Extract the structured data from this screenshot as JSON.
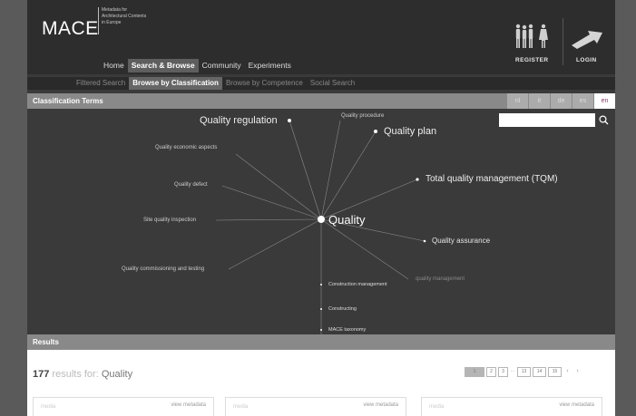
{
  "header": {
    "logo": "MACE",
    "tagline_lines": [
      "Metadata for",
      "Architectural Contents",
      "in Europe"
    ],
    "register_label": "REGISTER",
    "login_label": "LOGIN"
  },
  "nav": {
    "items": [
      {
        "label": "Home",
        "active": false
      },
      {
        "label": "Search & Browse",
        "active": true
      },
      {
        "label": "Community",
        "active": false
      },
      {
        "label": "Experiments",
        "active": false
      }
    ]
  },
  "subnav": {
    "items": [
      {
        "label": "Filtered Search",
        "active": false
      },
      {
        "label": "Browse by Classification",
        "active": true
      },
      {
        "label": "Browse by Competence",
        "active": false
      },
      {
        "label": "Social Search",
        "active": false
      }
    ]
  },
  "classification": {
    "title": "Classification Terms",
    "languages": [
      {
        "code": "nl",
        "active": false
      },
      {
        "code": "it",
        "active": false
      },
      {
        "code": "de",
        "active": false
      },
      {
        "code": "es",
        "active": false
      },
      {
        "code": "en",
        "active": true
      }
    ],
    "search_value": "",
    "center": "Quality",
    "terms": [
      {
        "label": "Quality regulation",
        "dot": true
      },
      {
        "label": "Quality procedure",
        "dot": false
      },
      {
        "label": "Quality plan",
        "dot": true
      },
      {
        "label": "Quality economic aspects",
        "dot": false
      },
      {
        "label": "Total quality management (TQM)",
        "dot": true
      },
      {
        "label": "Quality defect",
        "dot": false
      },
      {
        "label": "Site quality inspection",
        "dot": false
      },
      {
        "label": "Quality assurance",
        "dot": true
      },
      {
        "label": "Quality commissioning and testing",
        "dot": false
      },
      {
        "label": "quality management",
        "dot": false
      },
      {
        "label": "Construction management",
        "dot": true
      },
      {
        "label": "Constructing",
        "dot": true
      },
      {
        "label": "MACE taxonomy",
        "dot": true
      }
    ]
  },
  "results": {
    "bar_title": "Results",
    "count": "177",
    "query_prefix": "results for:",
    "query": "Quality",
    "pages": [
      "1",
      "2",
      "3",
      "...",
      "13",
      "14",
      "15"
    ],
    "current_page": "1",
    "prev": "‹",
    "next": "›",
    "cards": [
      {
        "placeholder": "media",
        "link": "view metadata"
      },
      {
        "placeholder": "media",
        "link": "view metadata"
      },
      {
        "placeholder": "media",
        "link": "view metadata"
      }
    ]
  }
}
